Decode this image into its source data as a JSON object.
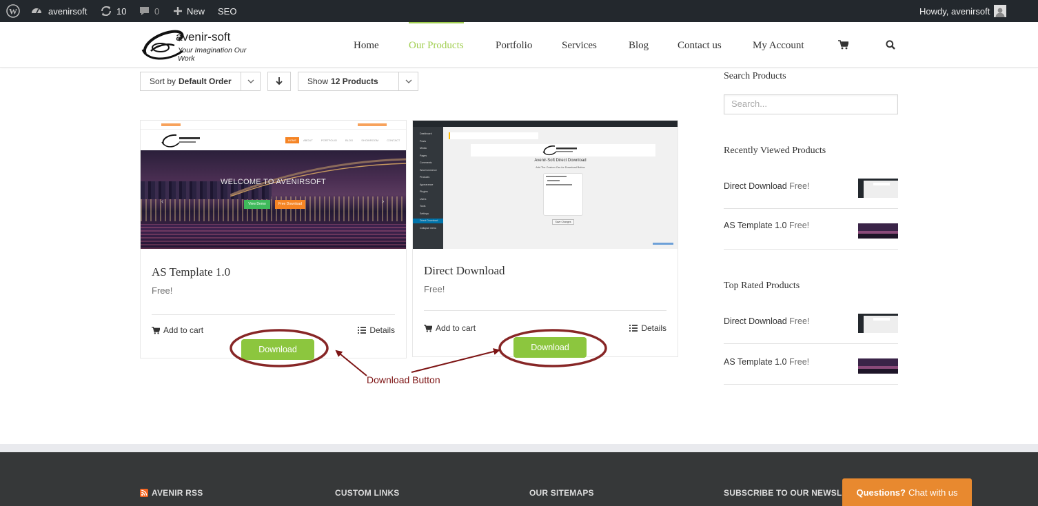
{
  "admin_bar": {
    "site_name": "avenirsoft",
    "updates": "10",
    "comments": "0",
    "new_label": "New",
    "seo_label": "SEO",
    "howdy": "Howdy, avenirsoft"
  },
  "header": {
    "logo_title": "avenir-soft",
    "logo_tagline": "Your Imagination Our Work",
    "nav": [
      {
        "label": "Home"
      },
      {
        "label": "Our Products"
      },
      {
        "label": "Portfolio"
      },
      {
        "label": "Services"
      },
      {
        "label": "Blog"
      },
      {
        "label": "Contact us"
      },
      {
        "label": "My Account"
      }
    ],
    "accent_color": "#a0ce4e"
  },
  "toolbar": {
    "sort_prefix": "Sort by",
    "sort_value": "Default Order",
    "show_prefix": "Show",
    "show_value": "12 Products"
  },
  "products": [
    {
      "title": "AS Template 1.0",
      "price": "Free!",
      "add_to_cart": "Add to cart",
      "details": "Details",
      "download": "Download",
      "thumb": {
        "menu": [
          "HOME",
          "ABOUT",
          "PORTFOLIO",
          "BLOG",
          "SHOWROOM",
          "CONTACT"
        ],
        "welcome": "WELCOME TO AVENIRSOFT",
        "btn_demo": "View Demo",
        "btn_free": "Free Download"
      }
    },
    {
      "title": "Direct Download",
      "price": "Free!",
      "add_to_cart": "Add to cart",
      "details": "Details",
      "download": "Download",
      "thumb": {
        "heading": "Avenir-Soft Direct Download",
        "subheading": "Add The Custom Css for Download Button",
        "save": "Save Changes",
        "sidebar": [
          "Dashboard",
          "Posts",
          "Media",
          "Pages",
          "Comments",
          "WooCommerce",
          "Products",
          "Appearance",
          "Plugins",
          "Users",
          "Tools",
          "Settings",
          "Direct Download",
          "Collapse menu"
        ]
      }
    }
  ],
  "annotation": {
    "label": "Download Button",
    "color": "#7d1414"
  },
  "sidebar": {
    "search_title": "Search Products",
    "search_placeholder": "Search...",
    "recent_title": "Recently Viewed Products",
    "recent": [
      {
        "name": "Direct Download",
        "price": "Free!"
      },
      {
        "name": "AS Template 1.0",
        "price": "Free!"
      }
    ],
    "top_title": "Top Rated Products",
    "top": [
      {
        "name": "Direct Download",
        "price": "Free!"
      },
      {
        "name": "AS Template 1.0",
        "price": "Free!"
      }
    ]
  },
  "footer": {
    "cols": [
      "AVENIR RSS",
      "CUSTOM LINKS",
      "OUR SITEMAPS",
      "SUBSCRIBE TO OUR NEWSLETTER"
    ],
    "chat_bold": "Questions?",
    "chat_text": "Chat with us"
  }
}
